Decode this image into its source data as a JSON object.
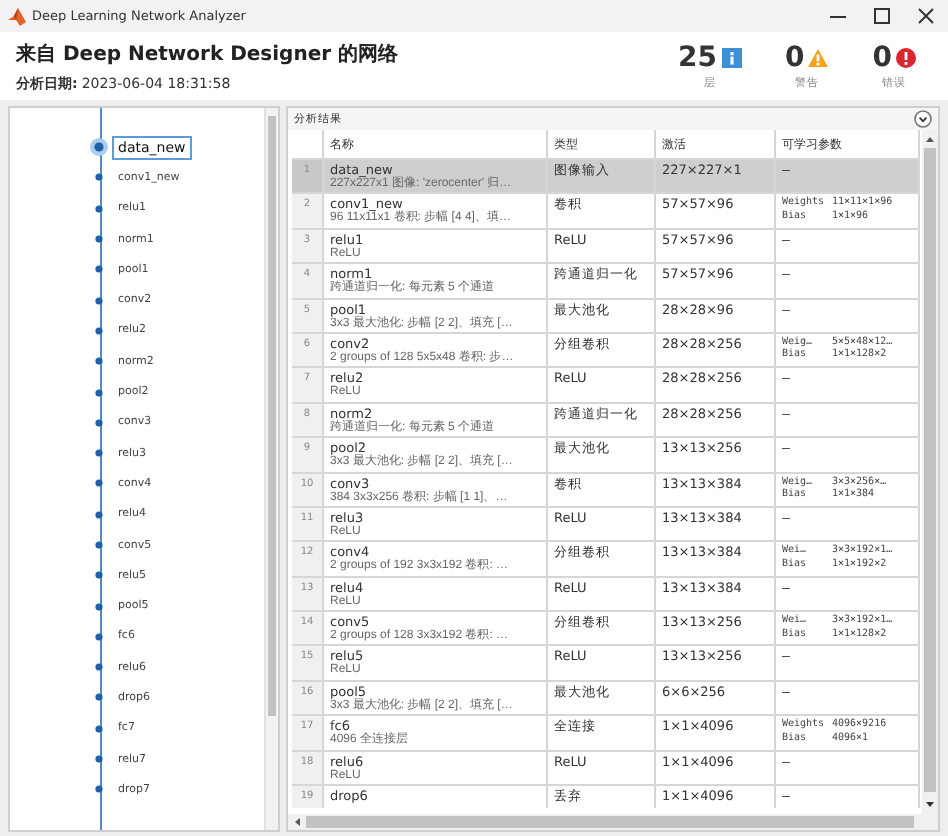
{
  "window": {
    "title": "Deep Learning Network Analyzer"
  },
  "header": {
    "title": "来自 Deep Network Designer 的网络",
    "date_label": "分析日期:",
    "date": "2023-06-04 18:31:58"
  },
  "summary": [
    {
      "kind": "info",
      "count": "25",
      "label": "层"
    },
    {
      "kind": "warning",
      "count": "0",
      "label": "警告"
    },
    {
      "kind": "error",
      "count": "0",
      "label": "错误"
    }
  ],
  "graph": {
    "nodes": [
      {
        "label": "data_new",
        "selected": true
      },
      {
        "label": "conv1_new",
        "selected": false
      },
      {
        "label": "relu1",
        "selected": false
      },
      {
        "label": "norm1",
        "selected": false
      },
      {
        "label": "pool1",
        "selected": false
      },
      {
        "label": "conv2",
        "selected": false
      },
      {
        "label": "relu2",
        "selected": false
      },
      {
        "label": "norm2",
        "selected": false
      },
      {
        "label": "pool2",
        "selected": false
      },
      {
        "label": "conv3",
        "selected": false
      },
      {
        "label": "relu3",
        "selected": false
      },
      {
        "label": "conv4",
        "selected": false
      },
      {
        "label": "relu4",
        "selected": false
      },
      {
        "label": "conv5",
        "selected": false
      },
      {
        "label": "relu5",
        "selected": false
      },
      {
        "label": "pool5",
        "selected": false
      },
      {
        "label": "fc6",
        "selected": false
      },
      {
        "label": "relu6",
        "selected": false
      },
      {
        "label": "drop6",
        "selected": false
      },
      {
        "label": "fc7",
        "selected": false
      },
      {
        "label": "relu7",
        "selected": false
      },
      {
        "label": "drop7",
        "selected": false
      }
    ]
  },
  "results": {
    "title": "分析结果",
    "columns": [
      "名称",
      "类型",
      "激活",
      "可学习参数"
    ],
    "rows": [
      {
        "index": "1",
        "name": "data_new",
        "description": "227x227x1 图像: 'zerocenter' 归…",
        "type": "图像输入",
        "activations": "227×227×1",
        "learnables": "–",
        "selected": true
      },
      {
        "index": "2",
        "name": "conv1_new",
        "description": "96 11x11x1 卷积: 步幅 [4 4]、填…",
        "type": "卷积",
        "activations": "57×57×96",
        "learnables": [
          {
            "name": "Weights",
            "value": "11×11×1×96"
          },
          {
            "name": "Bias",
            "value": "1×1×96"
          }
        ],
        "selected": false
      },
      {
        "index": "3",
        "name": "relu1",
        "description": "ReLU",
        "type": "ReLU",
        "activations": "57×57×96",
        "learnables": "–",
        "selected": false
      },
      {
        "index": "4",
        "name": "norm1",
        "description": "跨通道归一化: 每元素 5 个通道",
        "type": "跨通道归一化",
        "activations": "57×57×96",
        "learnables": "–",
        "selected": false
      },
      {
        "index": "5",
        "name": "pool1",
        "description": "3x3 最大池化: 步幅 [2 2]、填充 […",
        "type": "最大池化",
        "activations": "28×28×96",
        "learnables": "–",
        "selected": false
      },
      {
        "index": "6",
        "name": "conv2",
        "description": "2 groups of 128 5x5x48 卷积: 步…",
        "type": "分组卷积",
        "activations": "28×28×256",
        "learnables": [
          {
            "name": "Weig…",
            "value": "5×5×48×12…"
          },
          {
            "name": "Bias",
            "value": "1×1×128×2"
          }
        ],
        "selected": false
      },
      {
        "index": "7",
        "name": "relu2",
        "description": "ReLU",
        "type": "ReLU",
        "activations": "28×28×256",
        "learnables": "–",
        "selected": false
      },
      {
        "index": "8",
        "name": "norm2",
        "description": "跨通道归一化: 每元素 5 个通道",
        "type": "跨通道归一化",
        "activations": "28×28×256",
        "learnables": "–",
        "selected": false
      },
      {
        "index": "9",
        "name": "pool2",
        "description": "3x3 最大池化: 步幅 [2 2]、填充 […",
        "type": "最大池化",
        "activations": "13×13×256",
        "learnables": "–",
        "selected": false
      },
      {
        "index": "10",
        "name": "conv3",
        "description": "384 3x3x256 卷积: 步幅 [1 1]、…",
        "type": "卷积",
        "activations": "13×13×384",
        "learnables": [
          {
            "name": "Weig…",
            "value": "3×3×256×…"
          },
          {
            "name": "Bias",
            "value": "1×1×384"
          }
        ],
        "selected": false
      },
      {
        "index": "11",
        "name": "relu3",
        "description": "ReLU",
        "type": "ReLU",
        "activations": "13×13×384",
        "learnables": "–",
        "selected": false
      },
      {
        "index": "12",
        "name": "conv4",
        "description": "2 groups of 192 3x3x192 卷积: …",
        "type": "分组卷积",
        "activations": "13×13×384",
        "learnables": [
          {
            "name": "Wei…",
            "value": "3×3×192×1…"
          },
          {
            "name": "Bias",
            "value": "1×1×192×2"
          }
        ],
        "selected": false
      },
      {
        "index": "13",
        "name": "relu4",
        "description": "ReLU",
        "type": "ReLU",
        "activations": "13×13×384",
        "learnables": "–",
        "selected": false
      },
      {
        "index": "14",
        "name": "conv5",
        "description": "2 groups of 128 3x3x192 卷积: …",
        "type": "分组卷积",
        "activations": "13×13×256",
        "learnables": [
          {
            "name": "Wei…",
            "value": "3×3×192×1…"
          },
          {
            "name": "Bias",
            "value": "1×1×128×2"
          }
        ],
        "selected": false
      },
      {
        "index": "15",
        "name": "relu5",
        "description": "ReLU",
        "type": "ReLU",
        "activations": "13×13×256",
        "learnables": "–",
        "selected": false
      },
      {
        "index": "16",
        "name": "pool5",
        "description": "3x3 最大池化: 步幅 [2 2]、填充 […",
        "type": "最大池化",
        "activations": "6×6×256",
        "learnables": "–",
        "selected": false
      },
      {
        "index": "17",
        "name": "fc6",
        "description": "4096 全连接层",
        "type": "全连接",
        "activations": "1×1×4096",
        "learnables": [
          {
            "name": "Weights",
            "value": "4096×9216"
          },
          {
            "name": "Bias",
            "value": "4096×1"
          }
        ],
        "selected": false
      },
      {
        "index": "18",
        "name": "relu6",
        "description": "ReLU",
        "type": "ReLU",
        "activations": "1×1×4096",
        "learnables": "–",
        "selected": false
      },
      {
        "index": "19",
        "name": "drop6",
        "type": "丢弃",
        "activations": "1×1×4096",
        "learnables": "–",
        "selected": false
      }
    ]
  }
}
